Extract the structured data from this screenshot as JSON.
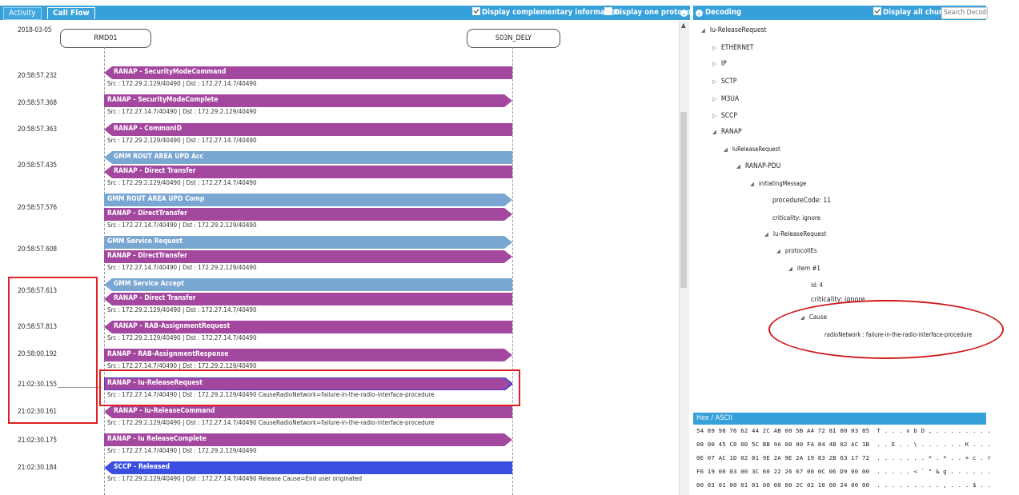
{
  "left_header": {
    "tab_activity": "Activity",
    "tab_callflow": "Call Flow",
    "opt_complementary": "Display complementary information",
    "opt_one_protocol": "Display one protocol"
  },
  "date_label": "2018-03-05",
  "entities": {
    "left": "RMD01",
    "right": "S03N_DELY"
  },
  "times": {
    "t1": "20:58:57.232",
    "t2": "20:58:57.368",
    "t3": "20:58:57.363",
    "t4": "20:58:57.435",
    "t5": "20:58:57.576",
    "t6": "20:58:57.608",
    "t7": "20:58:57.613",
    "t8": "20:58:57.813",
    "t9": "20:58:00.192",
    "t10": "21:02:30.155",
    "t11": "21:02:30.161",
    "t12": "21:02:30.175",
    "t13": "21:02:30.184"
  },
  "messages": {
    "m1": {
      "label": "RANAP - SecurityModeCommand",
      "sub": "Src : 172.29.2.129/40490 | Dst : 172.27.14.7/40490"
    },
    "m2": {
      "label": "RANAP - SecurityModeComplete",
      "sub": "Src : 172.27.14.7/40490 | Dst : 172.29.2.129/40490"
    },
    "m3": {
      "label": "RANAP - CommonID",
      "sub": "Src : 172.29.2.129/40490 | Dst : 172.27.14.7/40490"
    },
    "m4a": {
      "label": "GMM ROUT AREA UPD Acc"
    },
    "m4b": {
      "label": "RANAP - Direct Transfer",
      "sub": "Src : 172.29.2.129/40490 | Dst : 172.27.14.7/40490"
    },
    "m5a": {
      "label": "GMM ROUT AREA UPD Comp"
    },
    "m5b": {
      "label": "RANAP - DirectTransfer",
      "sub": "Src : 172.27.14.7/40490 | Dst : 172.29.2.129/40490"
    },
    "m6a": {
      "label": "GMM Service Request"
    },
    "m6b": {
      "label": "RANAP - DirectTransfer",
      "sub": "Src : 172.27.14.7/40490 | Dst : 172.29.2.129/40490"
    },
    "m7a": {
      "label": "GMM Service Accept"
    },
    "m7b": {
      "label": "RANAP - Direct Transfer",
      "sub": "Src : 172.29.2.129/40490 | Dst : 172.27.14.7/40490"
    },
    "m8": {
      "label": "RANAP - RAB-AssignmentRequest",
      "sub": "Src : 172.29.2.129/40490 | Dst : 172.27.14.7/40490"
    },
    "m9": {
      "label": "RANAP - RAB-AssignmentResponse",
      "sub": "Src : 172.27.14.7/40490 | Dst : 172.29.2.129/40490"
    },
    "m10": {
      "label": "RANAP - Iu-ReleaseRequest",
      "sub": "Src : 172.27.14.7/40490 | Dst : 172.29.2.129/40490 CauseRadioNetwork=failure-in-the-radio-interface-procedure"
    },
    "m11": {
      "label": "RANAP - Iu-ReleaseCommand",
      "sub": "Src : 172.29.2.129/40490 | Dst : 172.27.14.7/40490 CauseRadioNetwork=failure-in-the-radio-interface-procedure"
    },
    "m12": {
      "label": "RANAP - Iu ReleaseComplete",
      "sub": "Src : 172.27.14.7/40490 | Dst : 172.29.2.129/40490"
    },
    "m13": {
      "label": "SCCP - Released",
      "sub": "Src : 172.29.2.129/40490 | Dst : 172.27.14.7/40490 Release Cause=End user originated"
    }
  },
  "colors": {
    "header": "#35a0da",
    "ranap": "#a4479f",
    "gmm": "#7aa7d2",
    "sccp": "#3a4fe0",
    "highlight": "#e02020"
  },
  "right_header": {
    "title": "Decoding",
    "opt_all_chunks": "Display all chunks",
    "search_placeholder": "Search Decoding"
  },
  "tree": {
    "root": "Iu-ReleaseRequest",
    "n1": "ETHERNET",
    "n2": "IP",
    "n3": "SCTP",
    "n4": "M3UA",
    "n5": "SCCP",
    "n6": "RANAP",
    "n7": "IuReleaseRequest",
    "n8": "RANAP-PDU",
    "n9": "initiatingMessage",
    "n10": "procedureCode: 11",
    "n11": "criticality: ignore",
    "n12": "Iu-ReleaseRequest",
    "n13": "protocolIEs",
    "n14": "item #1",
    "n15": "id: 4",
    "n16": "criticality: ignore",
    "n17": "Cause",
    "n18": "radioNetwork : failure-in-the-radio-interface-procedure"
  },
  "hex": {
    "title": "Hex / ASCII",
    "r1": "54 89 98 76 62 44 2C AB 00 5B A4 72 81 00 03 85  T . . . v b D , . . . . . . . .",
    "r2": "08 00 45 C0 00 5C BB 9A 00 00 FA 84 4B 02 AC 1B  . . E . . \\ . . . . . . K . . .",
    "r3": "0E 07 AC 1D 02 81 9E 2A 9E 2A 19 83 2B 63 17 72  . . . . . . . * . * . . + c . r",
    "r4": "F6 19 00 03 00 3C 60 22 26 67 00 0C 06 D9 00 00  . . . . . < ` \" & g . . . . . .",
    "r5": "00 03 01 00 01 01 00 00 00 2C 02 10 00 24 00 00  . . . . . . . . . , . . . $ . ."
  }
}
